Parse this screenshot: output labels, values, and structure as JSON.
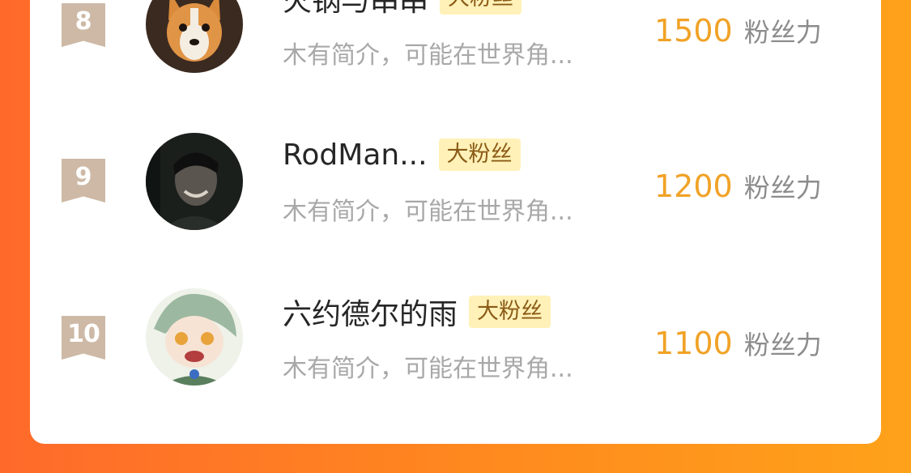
{
  "ranking": {
    "items": [
      {
        "rank": "8",
        "name": "火锅与串串",
        "badge": "大粉丝",
        "desc": "木有简介，可能在世界角...",
        "score": "1500",
        "unit": "粉丝力",
        "avatar_icon": "corgi-dog-avatar"
      },
      {
        "rank": "9",
        "name": "RodMan...",
        "badge": "大粉丝",
        "desc": "木有简介，可能在世界角...",
        "score": "1200",
        "unit": "粉丝力",
        "avatar_icon": "dark-portrait-avatar"
      },
      {
        "rank": "10",
        "name": "六约德尔的雨",
        "badge": "大粉丝",
        "desc": "木有简介，可能在世界角...",
        "score": "1100",
        "unit": "粉丝力",
        "avatar_icon": "anime-character-avatar"
      }
    ]
  },
  "colors": {
    "background_start": "#ff6a2b",
    "background_end": "#ffa21a",
    "score": "#f1a227",
    "badge_bg": "#fff1b8",
    "rank_badge": "#cdb9a6"
  }
}
